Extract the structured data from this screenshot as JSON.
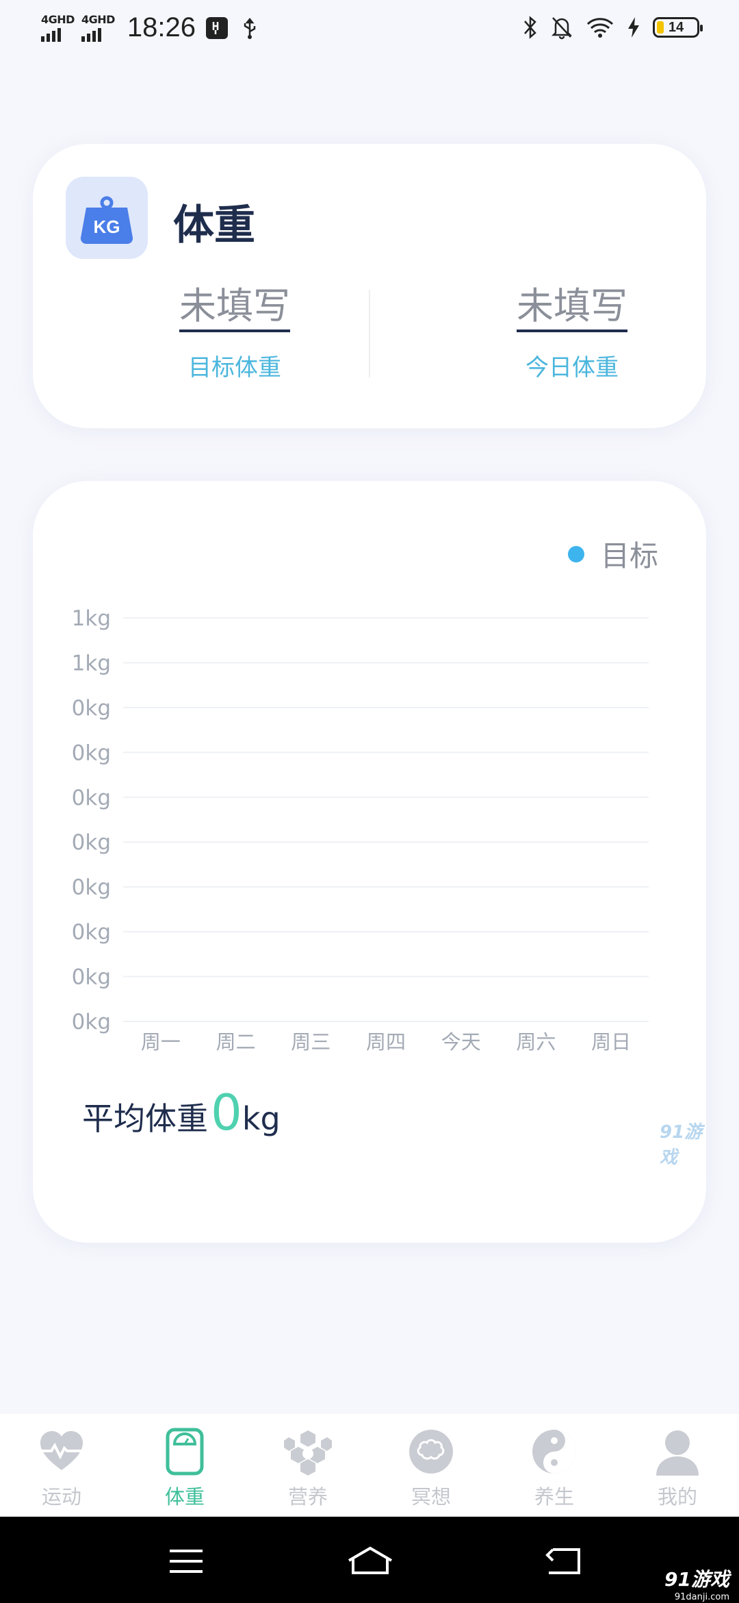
{
  "status_bar": {
    "network_1": "4GHD",
    "network_2": "4GHD",
    "time": "18:26",
    "battery": "14"
  },
  "weight_card": {
    "icon_text": "KG",
    "title": "体重",
    "target": {
      "value": "未填写",
      "label": "目标体重"
    },
    "today": {
      "value": "未填写",
      "label": "今日体重"
    }
  },
  "chart_card": {
    "legend": "目标",
    "avg_label": "平均体重",
    "avg_value": "0",
    "avg_unit": "kg",
    "watermark": "91游戏"
  },
  "chart_data": {
    "type": "line",
    "title": "",
    "xlabel": "",
    "ylabel": "",
    "categories": [
      "周一",
      "周二",
      "周三",
      "周四",
      "今天",
      "周六",
      "周日"
    ],
    "y_tick_labels": [
      "1kg",
      "1kg",
      "0kg",
      "0kg",
      "0kg",
      "0kg",
      "0kg",
      "0kg",
      "0kg",
      "0kg"
    ],
    "series": [
      {
        "name": "目标",
        "values": []
      }
    ],
    "legend_position": "top-right",
    "grid": true,
    "colors": {
      "series": "#3db4ee",
      "grid": "#eef0f4",
      "tick": "#a3aab5"
    }
  },
  "tabs": [
    {
      "label": "运动",
      "icon": "heart-pulse-icon",
      "active": false
    },
    {
      "label": "体重",
      "icon": "scale-icon",
      "active": true
    },
    {
      "label": "营养",
      "icon": "honeycomb-icon",
      "active": false
    },
    {
      "label": "冥想",
      "icon": "brain-icon",
      "active": false
    },
    {
      "label": "养生",
      "icon": "yin-yang-icon",
      "active": false
    },
    {
      "label": "我的",
      "icon": "user-icon",
      "active": false
    }
  ],
  "nav_watermark": "91游戏",
  "nav_watermark_sub": "91danji.com",
  "colors": {
    "accent": "#3fbf9a",
    "link_blue": "#4bb6dd",
    "title_navy": "#1f2d4d",
    "icon_blue": "#4a7ee8"
  }
}
